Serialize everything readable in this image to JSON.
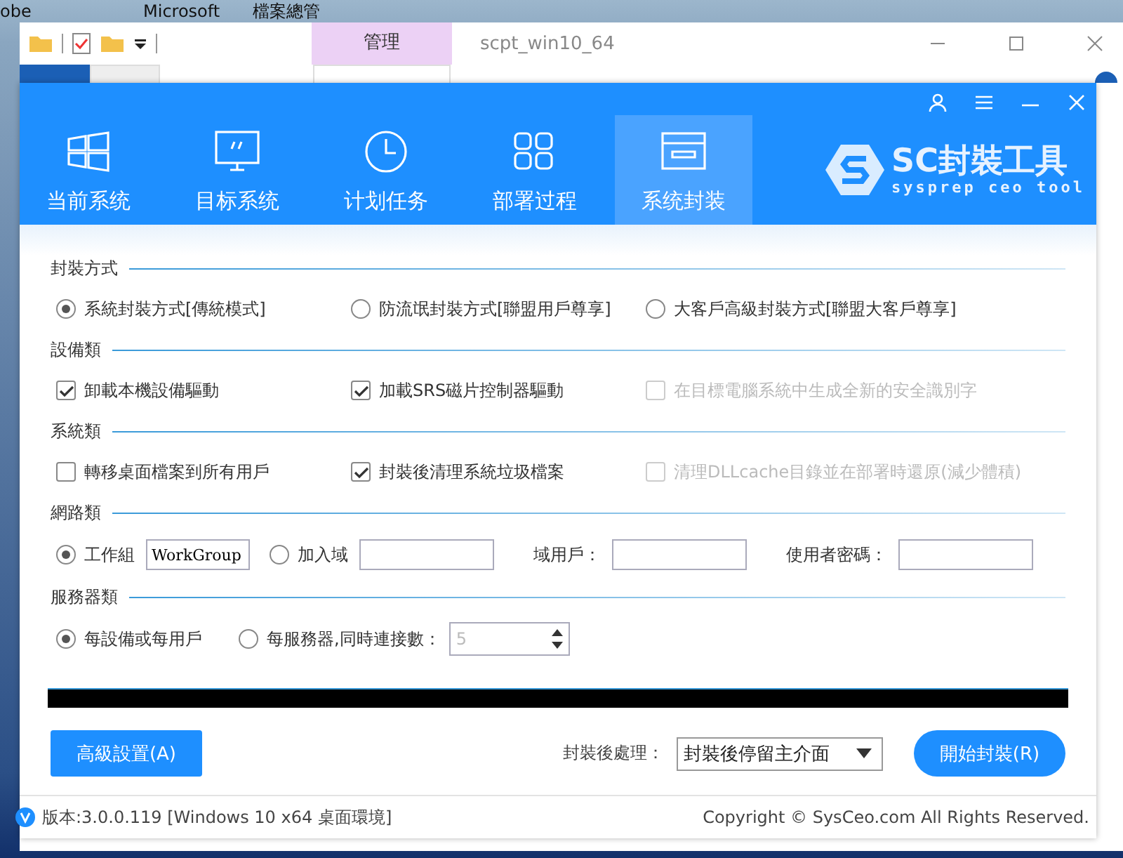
{
  "desktop": {
    "icons": [
      {
        "label": "obe"
      },
      {
        "label": "Microsoft"
      },
      {
        "label": "檔案總管"
      }
    ]
  },
  "explorer": {
    "context_tab": "管理",
    "title": "scpt_win10_64",
    "ribbon_tabs": [
      {
        "selected": true
      },
      {
        "selected": false
      },
      {
        "selected": false
      }
    ]
  },
  "app": {
    "nav": [
      {
        "label": "当前系统",
        "selected": false
      },
      {
        "label": "目标系统",
        "selected": false
      },
      {
        "label": "计划任务",
        "selected": false
      },
      {
        "label": "部署过程",
        "selected": false
      },
      {
        "label": "系统封装",
        "selected": true
      }
    ],
    "logo": {
      "name": "SC封裝工具",
      "tagline": "sysprep ceo tool"
    },
    "sections": [
      {
        "title": "封裝方式",
        "items": [
          {
            "kind": "radio",
            "label": "系統封裝方式[傳統模式]",
            "selected": true
          },
          {
            "kind": "radio",
            "label": "防流氓封裝方式[聯盟用戶尊享]",
            "selected": false
          },
          {
            "kind": "radio",
            "label": "大客戶高級封裝方式[聯盟大客戶尊享]",
            "selected": false
          }
        ]
      },
      {
        "title": "設備類",
        "items": [
          {
            "kind": "checkbox",
            "label": "卸載本機設備驅動",
            "checked": true,
            "disabled": false
          },
          {
            "kind": "checkbox",
            "label": "加載SRS磁片控制器驅動",
            "checked": true,
            "disabled": false
          },
          {
            "kind": "checkbox",
            "label": "在目標電腦系統中生成全新的安全識別字",
            "checked": false,
            "disabled": true
          }
        ]
      },
      {
        "title": "系統類",
        "items": [
          {
            "kind": "checkbox",
            "label": "轉移桌面檔案到所有用戶",
            "checked": false,
            "disabled": false
          },
          {
            "kind": "checkbox",
            "label": "封裝後清理系統垃圾檔案",
            "checked": true,
            "disabled": false
          },
          {
            "kind": "checkbox",
            "label": "清理DLLcache目錄並在部署時還原(減少體積)",
            "checked": false,
            "disabled": true
          }
        ]
      },
      {
        "title": "網路類",
        "items": [
          {
            "kind": "radio",
            "label": "工作組",
            "selected": true
          },
          {
            "kind": "field",
            "value": "WorkGroup"
          },
          {
            "kind": "radio",
            "label": "加入域",
            "selected": false
          },
          {
            "kind": "field"
          },
          {
            "kind": "label",
            "label": "域用戶："
          },
          {
            "kind": "field"
          },
          {
            "kind": "label",
            "label": "使用者密碼："
          },
          {
            "kind": "field"
          }
        ]
      },
      {
        "title": "服務器類",
        "items": [
          {
            "kind": "radio",
            "label": "每設備或每用戶",
            "selected": true
          },
          {
            "kind": "radio",
            "label": "每服務器,同時連接數：",
            "selected": false
          },
          {
            "kind": "spinner",
            "value": "5",
            "disabled": true
          }
        ]
      }
    ],
    "progress": {
      "level": 0
    },
    "advanced_button": "高級設置(A)",
    "after_label": "封裝後處理：",
    "after_value": "封裝後停留主介面",
    "start_button": "開始封裝(R)",
    "footer": {
      "version": "版本:3.0.0.119 [Windows 10 x64 桌面環境]",
      "copyright": "Copyright © SysCeo.com All Rights Reserved."
    }
  }
}
